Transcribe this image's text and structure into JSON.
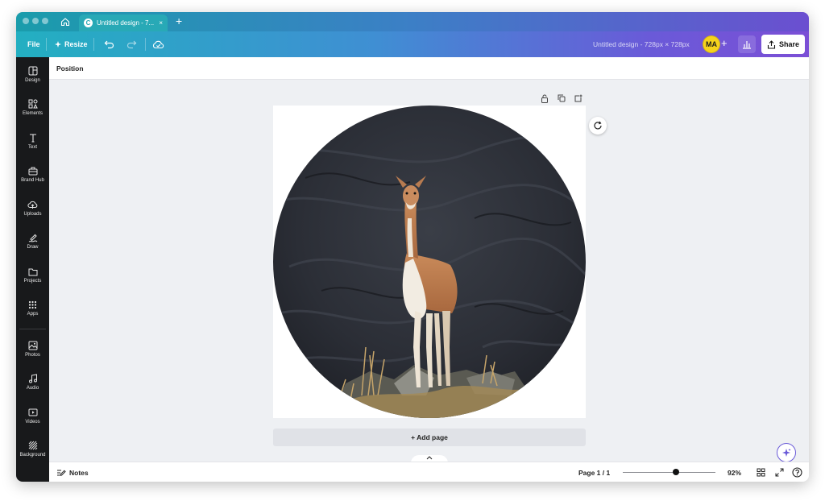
{
  "tabbar": {
    "tab_title": "Untitled design - 7...",
    "tab_logo": "C",
    "close_glyph": "×",
    "new_tab_glyph": "+"
  },
  "toolbar": {
    "file_label": "File",
    "resize_label": "Resize",
    "doc_title": "Untitled design - 728px × 728px",
    "avatar_initials": "MA",
    "plus_glyph": "+",
    "share_label": "Share"
  },
  "sidebar": {
    "items": [
      {
        "label": "Design",
        "icon": "design-icon"
      },
      {
        "label": "Elements",
        "icon": "elements-icon"
      },
      {
        "label": "Text",
        "icon": "text-icon"
      },
      {
        "label": "Brand Hub",
        "icon": "brand-hub-icon"
      },
      {
        "label": "Uploads",
        "icon": "uploads-icon"
      },
      {
        "label": "Draw",
        "icon": "draw-icon"
      },
      {
        "label": "Projects",
        "icon": "projects-icon"
      },
      {
        "label": "Apps",
        "icon": "apps-icon"
      },
      {
        "label": "Photos",
        "icon": "photos-icon"
      },
      {
        "label": "Audio",
        "icon": "audio-icon"
      },
      {
        "label": "Videos",
        "icon": "videos-icon"
      },
      {
        "label": "Background",
        "icon": "background-icon"
      }
    ]
  },
  "context": {
    "position_label": "Position"
  },
  "canvas": {
    "add_page_label": "+ Add page"
  },
  "footer": {
    "notes_label": "Notes",
    "page_count": "Page 1 / 1",
    "zoom": "92%",
    "zoom_fraction": 0.57
  },
  "colors": {
    "sidebar_bg": "#18191b",
    "accent_gradient_start": "#23afc1",
    "accent_gradient_end": "#7b4fd6",
    "avatar": "#f6d31c"
  }
}
